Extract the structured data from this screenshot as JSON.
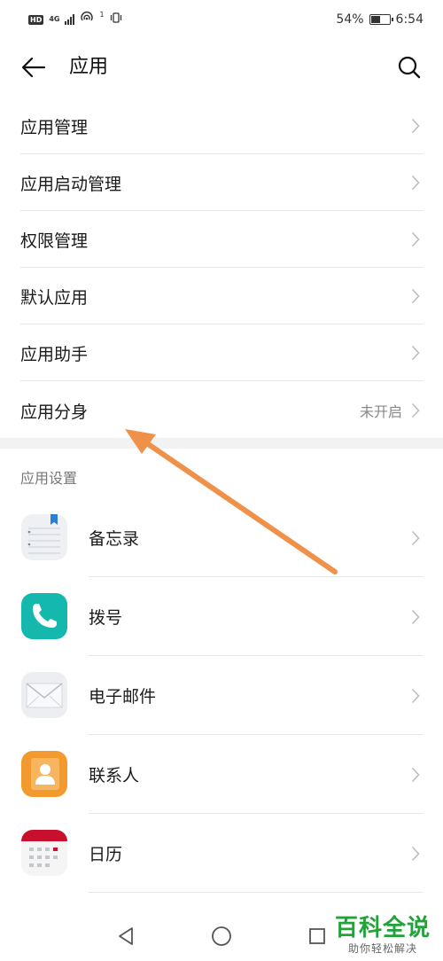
{
  "status_bar": {
    "hd": "HD",
    "network": "4G",
    "sim_index": "1",
    "battery_percent": "54%",
    "battery_level": 0.54,
    "time": "6:54"
  },
  "app_bar": {
    "title": "应用",
    "back_icon": "back-arrow-icon",
    "search_icon": "search-icon"
  },
  "menu": {
    "items": [
      {
        "label": "应用管理",
        "value": ""
      },
      {
        "label": "应用启动管理",
        "value": ""
      },
      {
        "label": "权限管理",
        "value": ""
      },
      {
        "label": "默认应用",
        "value": ""
      },
      {
        "label": "应用助手",
        "value": ""
      },
      {
        "label": "应用分身",
        "value": "未开启"
      }
    ]
  },
  "app_settings": {
    "header": "应用设置",
    "apps": [
      {
        "label": "备忘录",
        "icon": "notepad-icon"
      },
      {
        "label": "拨号",
        "icon": "phone-icon"
      },
      {
        "label": "电子邮件",
        "icon": "email-icon"
      },
      {
        "label": "联系人",
        "icon": "contacts-icon"
      },
      {
        "label": "日历",
        "icon": "calendar-icon"
      }
    ]
  },
  "watermark": {
    "main": "百科全说",
    "sub": "助你轻松解决"
  },
  "colors": {
    "arrow": "#f0914a",
    "phone": "#14b8ad",
    "contacts": "#f29a2e",
    "calendar": "#c8102e",
    "watermark": "#22a33a"
  }
}
